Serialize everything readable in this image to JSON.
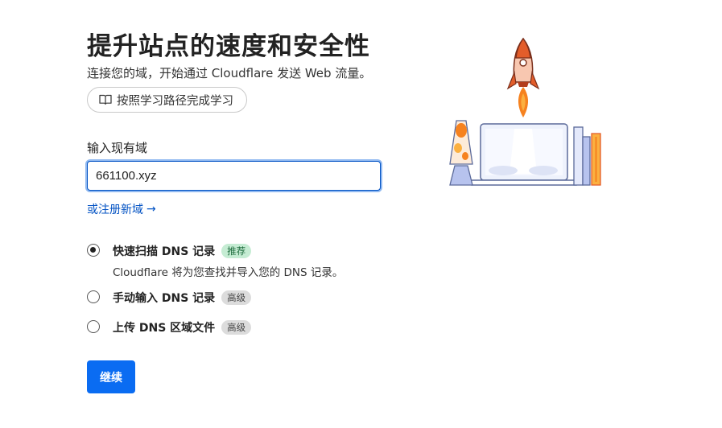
{
  "header": {
    "title": "提升站点的速度和安全性",
    "subtitle": "连接您的域，开始通过 Cloudflare 发送 Web 流量。",
    "learning_path_label": "按照学习路径完成学习",
    "learning_path_icon": "book-icon"
  },
  "form": {
    "field_label": "输入现有域",
    "domain_value": "661100.xyz",
    "register_link": "或注册新域",
    "register_arrow": "→"
  },
  "options": [
    {
      "title": "快速扫描 DNS 记录",
      "badge": "推荐",
      "description": "Cloudflare 将为您查找并导入您的 DNS 记录。",
      "selected": true
    },
    {
      "title": "手动输入 DNS 记录",
      "badge": "高级",
      "selected": false
    },
    {
      "title": "上传 DNS 区域文件",
      "badge": "高级",
      "selected": false
    }
  ],
  "actions": {
    "continue_label": "继续"
  },
  "colors": {
    "primary_blue": "#0a6cf2",
    "link_blue": "#0051c3",
    "rocket_orange": "#f6821f",
    "recommend_green_bg": "#c5ecd3"
  }
}
